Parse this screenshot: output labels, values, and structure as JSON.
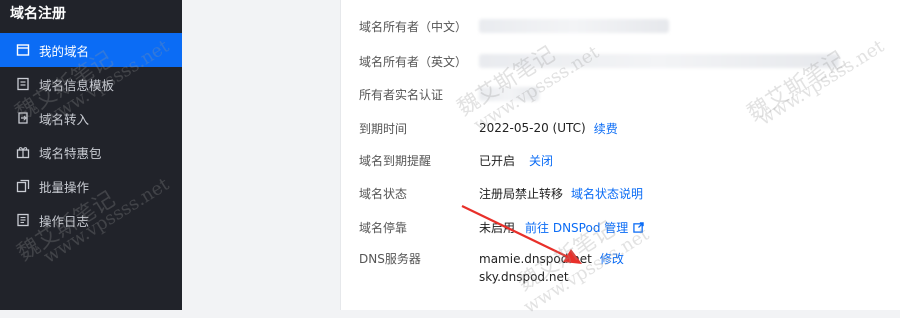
{
  "sidebar": {
    "title": "域名注册",
    "items": [
      {
        "label": "我的域名",
        "icon": "domain-icon",
        "active": true
      },
      {
        "label": "域名信息模板",
        "icon": "template-icon",
        "active": false
      },
      {
        "label": "域名转入",
        "icon": "transfer-icon",
        "active": false
      },
      {
        "label": "域名特惠包",
        "icon": "gift-icon",
        "active": false
      },
      {
        "label": "批量操作",
        "icon": "batch-icon",
        "active": false
      },
      {
        "label": "操作日志",
        "icon": "log-icon",
        "active": false
      }
    ]
  },
  "details": {
    "owner_cn_label": "域名所有者（中文）",
    "owner_en_label": "域名所有者（英文）",
    "realname_label": "所有者实名认证",
    "expiry_label": "到期时间",
    "expiry_value": "2022-05-20 (UTC)",
    "renew_link": "续费",
    "reminder_label": "域名到期提醒",
    "reminder_value": "已开启",
    "reminder_link": "关闭",
    "status_label": "域名状态",
    "status_value": "注册局禁止转移",
    "status_link": "域名状态说明",
    "parking_label": "域名停靠",
    "parking_value": "未启用",
    "parking_link": "前往 DNSPod 管理",
    "dns_label": "DNS服务器",
    "dns_servers": [
      "mamie.dnspod.net",
      "sky.dnspod.net"
    ],
    "dns_link": "修改"
  },
  "watermark": {
    "cn": "魏艾斯笔记",
    "url": "www.vpssss.net"
  },
  "colors": {
    "sidebar_bg": "#21232a",
    "active_item": "#0b6cf5",
    "link": "#0b6cf5",
    "arrow": "#e8302a"
  }
}
